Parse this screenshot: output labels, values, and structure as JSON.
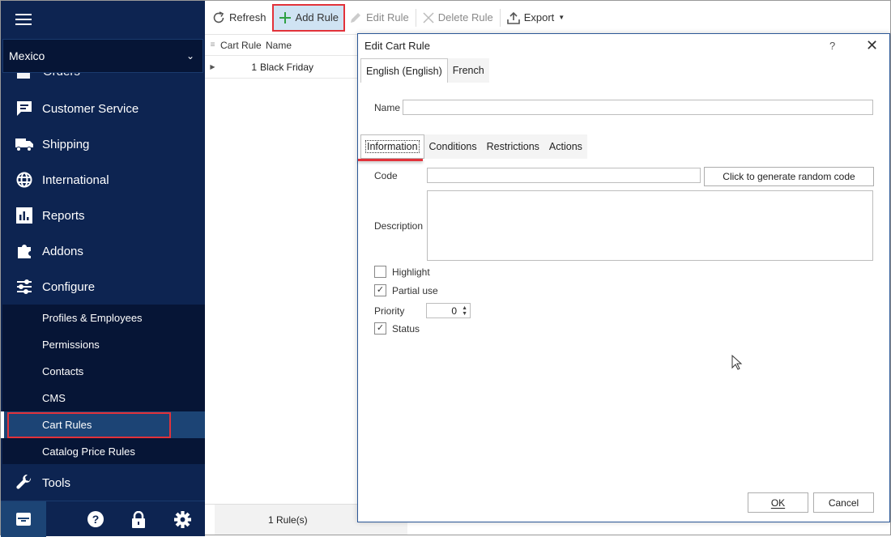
{
  "sidebar": {
    "store_selector": "Mexico",
    "partial_item": "Orders",
    "items": [
      {
        "label": "Customer Service",
        "icon": "chat-icon"
      },
      {
        "label": "Shipping",
        "icon": "truck-icon"
      },
      {
        "label": "International",
        "icon": "globe-icon"
      },
      {
        "label": "Reports",
        "icon": "bar-chart-icon"
      },
      {
        "label": "Addons",
        "icon": "puzzle-icon"
      },
      {
        "label": "Configure",
        "icon": "sliders-icon"
      }
    ],
    "configure_submenu": [
      {
        "label": "Profiles & Employees"
      },
      {
        "label": "Permissions"
      },
      {
        "label": "Contacts"
      },
      {
        "label": "CMS"
      },
      {
        "label": "Cart Rules",
        "active": true
      },
      {
        "label": "Catalog Price Rules"
      }
    ],
    "tools_label": "Tools",
    "bottom_icons": [
      "store-icon",
      "help-icon",
      "lock-icon",
      "gear-icon"
    ]
  },
  "toolbar": {
    "refresh": "Refresh",
    "add_rule": "Add Rule",
    "edit_rule": "Edit Rule",
    "delete_rule": "Delete Rule",
    "export": "Export"
  },
  "grid": {
    "columns": [
      "Cart Rule",
      "Name"
    ],
    "rows": [
      {
        "id": "1",
        "name": "Black Friday"
      }
    ],
    "status": "1 Rule(s)"
  },
  "dialog": {
    "title": "Edit Cart Rule",
    "help": "?",
    "language_tabs": [
      "English (English)",
      "French"
    ],
    "name_label": "Name",
    "name_value": "",
    "section_tabs": [
      "Information",
      "Conditions",
      "Restrictions",
      "Actions"
    ],
    "active_section": "Information",
    "code_label": "Code",
    "code_value": "",
    "generate_code_button": "Click to generate random code",
    "description_label": "Description",
    "description_value": "",
    "highlight_label": "Highlight",
    "highlight_checked": false,
    "partial_use_label": "Partial use",
    "partial_use_checked": true,
    "priority_label": "Priority",
    "priority_value": "0",
    "status_label": "Status",
    "status_checked": true,
    "ok_button": "OK",
    "cancel_button": "Cancel"
  },
  "colors": {
    "sidebar_bg": "#0d2451",
    "submenu_bg": "#061536",
    "active_item_bg": "#1c4475",
    "highlight_red": "#e2323a",
    "add_icon_green": "#2ea043"
  }
}
